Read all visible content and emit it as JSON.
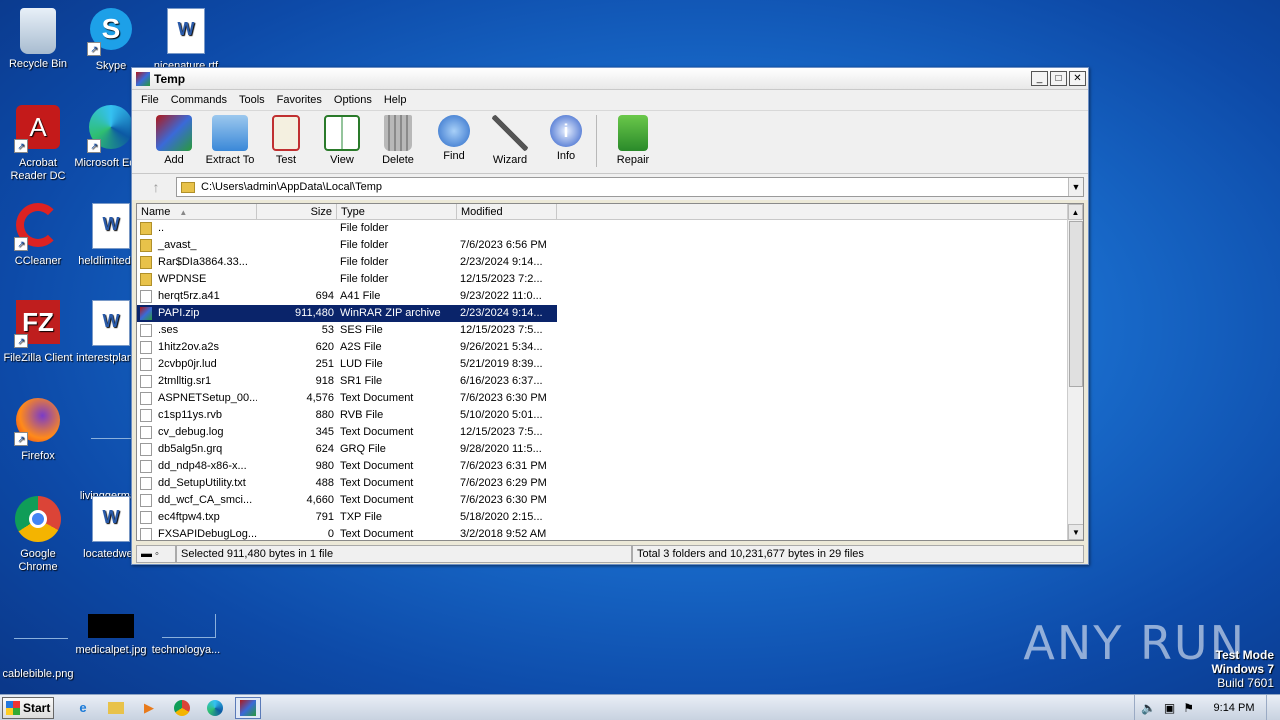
{
  "desktop": {
    "icons": [
      {
        "label": "Recycle Bin"
      },
      {
        "label": "Skype"
      },
      {
        "label": "nicenature.rtf"
      },
      {
        "label": "Acrobat Reader DC"
      },
      {
        "label": "Microsoft Edge"
      },
      {
        "label": "CCleaner"
      },
      {
        "label": "heldlimited.rtf"
      },
      {
        "label": "FileZilla Client"
      },
      {
        "label": "interestplan.rtf"
      },
      {
        "label": "Firefox"
      },
      {
        "label": "livinggerman"
      },
      {
        "label": "Google Chrome"
      },
      {
        "label": "locatedweb"
      },
      {
        "label": "cablebible.png"
      },
      {
        "label": "medicalpet.jpg"
      },
      {
        "label": "technologya..."
      }
    ],
    "watermark": "ANY RUN",
    "testmode": {
      "line1": "Test Mode",
      "line2": "Windows 7",
      "line3": "Build 7601"
    }
  },
  "window": {
    "title": "Temp",
    "menu": [
      "File",
      "Commands",
      "Tools",
      "Favorites",
      "Options",
      "Help"
    ],
    "toolbar": [
      "Add",
      "Extract To",
      "Test",
      "View",
      "Delete",
      "Find",
      "Wizard",
      "Info",
      "Repair"
    ],
    "address": "C:\\Users\\admin\\AppData\\Local\\Temp",
    "columns": {
      "name": "Name",
      "size": "Size",
      "type": "Type",
      "modified": "Modified"
    },
    "files": [
      {
        "name": "..",
        "size": "",
        "type": "File folder",
        "modified": "",
        "kind": "folder"
      },
      {
        "name": "_avast_",
        "size": "",
        "type": "File folder",
        "modified": "7/6/2023 6:56 PM",
        "kind": "folder"
      },
      {
        "name": "Rar$DIa3864.33...",
        "size": "",
        "type": "File folder",
        "modified": "2/23/2024 9:14...",
        "kind": "folder"
      },
      {
        "name": "WPDNSE",
        "size": "",
        "type": "File folder",
        "modified": "12/15/2023 7:2...",
        "kind": "folder"
      },
      {
        "name": "herqt5rz.a41",
        "size": "694",
        "type": "A41 File",
        "modified": "9/23/2022 11:0...",
        "kind": "file"
      },
      {
        "name": "PAPI.zip",
        "size": "911,480",
        "type": "WinRAR ZIP archive",
        "modified": "2/23/2024 9:14...",
        "kind": "zip",
        "selected": true
      },
      {
        "name": ".ses",
        "size": "53",
        "type": "SES File",
        "modified": "12/15/2023 7:5...",
        "kind": "file"
      },
      {
        "name": "1hitz2ov.a2s",
        "size": "620",
        "type": "A2S File",
        "modified": "9/26/2021 5:34...",
        "kind": "file"
      },
      {
        "name": "2cvbp0jr.lud",
        "size": "251",
        "type": "LUD File",
        "modified": "5/21/2019 8:39...",
        "kind": "file"
      },
      {
        "name": "2tmlltig.sr1",
        "size": "918",
        "type": "SR1 File",
        "modified": "6/16/2023 6:37...",
        "kind": "file"
      },
      {
        "name": "ASPNETSetup_00...",
        "size": "4,576",
        "type": "Text Document",
        "modified": "7/6/2023 6:30 PM",
        "kind": "file"
      },
      {
        "name": "c1sp11ys.rvb",
        "size": "880",
        "type": "RVB File",
        "modified": "5/10/2020 5:01...",
        "kind": "file"
      },
      {
        "name": "cv_debug.log",
        "size": "345",
        "type": "Text Document",
        "modified": "12/15/2023 7:5...",
        "kind": "file"
      },
      {
        "name": "db5alg5n.grq",
        "size": "624",
        "type": "GRQ File",
        "modified": "9/28/2020 11:5...",
        "kind": "file"
      },
      {
        "name": "dd_ndp48-x86-x...",
        "size": "980",
        "type": "Text Document",
        "modified": "7/6/2023 6:31 PM",
        "kind": "file"
      },
      {
        "name": "dd_SetupUtility.txt",
        "size": "488",
        "type": "Text Document",
        "modified": "7/6/2023 6:29 PM",
        "kind": "file"
      },
      {
        "name": "dd_wcf_CA_smci...",
        "size": "4,660",
        "type": "Text Document",
        "modified": "7/6/2023 6:30 PM",
        "kind": "file"
      },
      {
        "name": "ec4ftpw4.txp",
        "size": "791",
        "type": "TXP File",
        "modified": "5/18/2020 2:15...",
        "kind": "file"
      },
      {
        "name": "FXSAPIDebugLog...",
        "size": "0",
        "type": "Text Document",
        "modified": "3/2/2018 9:52 AM",
        "kind": "file"
      }
    ],
    "status_left": "Selected 911,480 bytes in 1 file",
    "status_right": "Total 3 folders and 10,231,677 bytes in 29 files"
  },
  "taskbar": {
    "start": "Start",
    "clock": "9:14 PM"
  }
}
